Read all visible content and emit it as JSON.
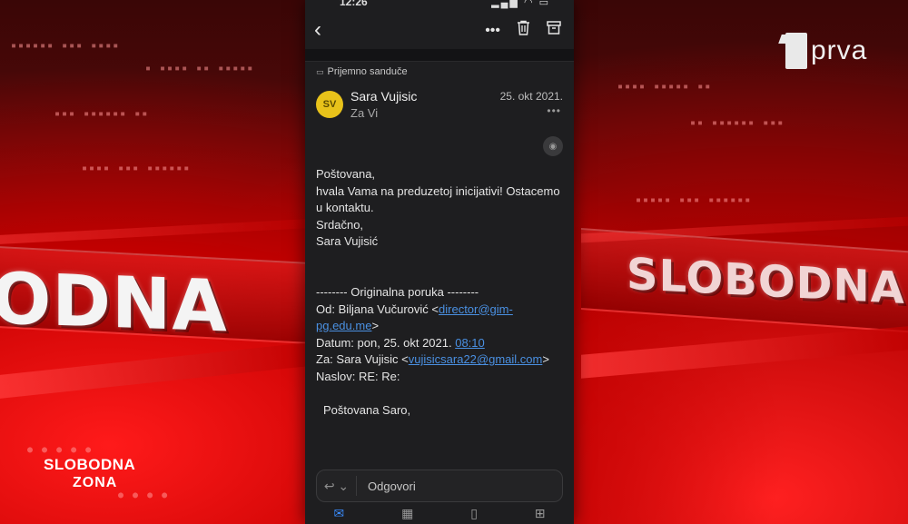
{
  "phone": {
    "status_bar": {
      "time": "12:26"
    },
    "folder": "Prijemno sanduče",
    "email": {
      "avatar_initials": "SV",
      "sender": "Sara Vujisic",
      "to": "Za Vi",
      "date": "25. okt 2021.",
      "body": {
        "greeting": "Poštovana,",
        "line1": "hvala Vama na preduzetoj inicijativi! Ostacemo u kontaktu.",
        "closing": "Srdačno,",
        "signature": "Sara Vujisić",
        "forward_header": "-------- Originalna poruka --------",
        "from_label": "Od: Biljana Vučurović <",
        "from_email": "director@gim-pg.edu.me",
        "from_end": ">",
        "date_label": "Datum: pon, 25. okt 2021. ",
        "date_time": "08:10",
        "to_label": "Za: Sara Vujisic <",
        "to_email": "vujisicsara22@gmail.com",
        "to_end": ">",
        "subject": "Naslov: RE: Re:",
        "quoted_greeting": "Poštovana Saro,"
      }
    },
    "reply": {
      "label": "Odgovori"
    }
  },
  "overlay": {
    "channel_brand": "prva",
    "bg_text_left": "ODNA",
    "bg_text_right": "SLOBODNA ZO",
    "show_logo_line1": "SLOBODNA",
    "show_logo_line2": "ZONA"
  },
  "colors": {
    "accent_blue": "#3a8dff",
    "avatar_yellow": "#e8c21a",
    "background_red": "#b10000"
  }
}
